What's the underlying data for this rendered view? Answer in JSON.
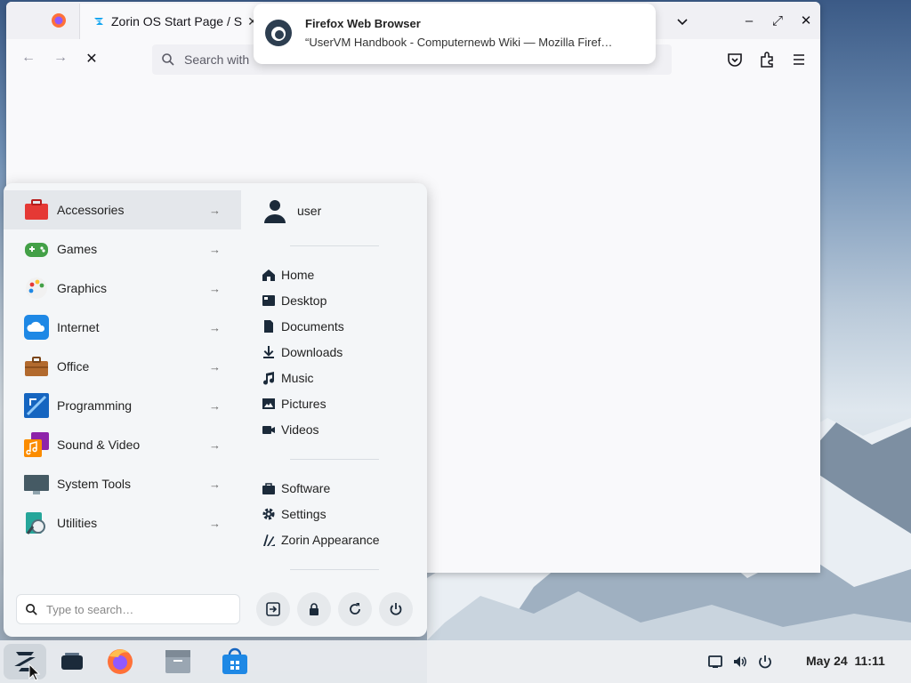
{
  "browser": {
    "active_tab_title": "Zorin OS Start Page / S",
    "search_placeholder": "Search with",
    "window_controls": [
      "chevron-down-icon",
      "minimize-icon",
      "maximize-icon",
      "close-icon"
    ]
  },
  "notification": {
    "title": "Firefox Web Browser",
    "body": "“UserVM Handbook - Computernewb Wiki — Mozilla Firef…"
  },
  "menu": {
    "categories": [
      {
        "label": "Accessories",
        "icon": "toolbox-icon",
        "color": "#e53935"
      },
      {
        "label": "Games",
        "icon": "gamepad-icon",
        "color": "#43a047"
      },
      {
        "label": "Graphics",
        "icon": "palette-icon",
        "color": "#f5f5f5"
      },
      {
        "label": "Internet",
        "icon": "cloud-icon",
        "color": "#1e88e5"
      },
      {
        "label": "Office",
        "icon": "briefcase-icon",
        "color": "#b26a2e"
      },
      {
        "label": "Programming",
        "icon": "code-icon",
        "color": "#1565c0"
      },
      {
        "label": "Sound & Video",
        "icon": "music-video-icon",
        "color": "#8e24aa"
      },
      {
        "label": "System Tools",
        "icon": "monitor-icon",
        "color": "#455a64"
      },
      {
        "label": "Utilities",
        "icon": "utilities-icon",
        "color": "#26a69a"
      }
    ],
    "user": "user",
    "places": [
      {
        "label": "Home",
        "icon": "home-icon"
      },
      {
        "label": "Desktop",
        "icon": "desktop-icon"
      },
      {
        "label": "Documents",
        "icon": "document-icon"
      },
      {
        "label": "Downloads",
        "icon": "download-icon"
      },
      {
        "label": "Music",
        "icon": "music-icon"
      },
      {
        "label": "Pictures",
        "icon": "picture-icon"
      },
      {
        "label": "Videos",
        "icon": "video-icon"
      }
    ],
    "system": [
      {
        "label": "Software",
        "icon": "bag-icon"
      },
      {
        "label": "Settings",
        "icon": "gear-icon"
      },
      {
        "label": "Zorin Appearance",
        "icon": "appearance-icon"
      }
    ],
    "search_placeholder": "Type to search…",
    "power_buttons": [
      "logout-icon",
      "lock-icon",
      "restart-icon",
      "power-icon"
    ]
  },
  "taskbar": {
    "apps": [
      "zorin-menu-icon",
      "workspaces-icon",
      "firefox-icon",
      "files-icon",
      "software-store-icon"
    ],
    "tray": [
      "display-icon",
      "volume-icon",
      "power-icon"
    ],
    "date": "May 24",
    "time": "11:11"
  }
}
